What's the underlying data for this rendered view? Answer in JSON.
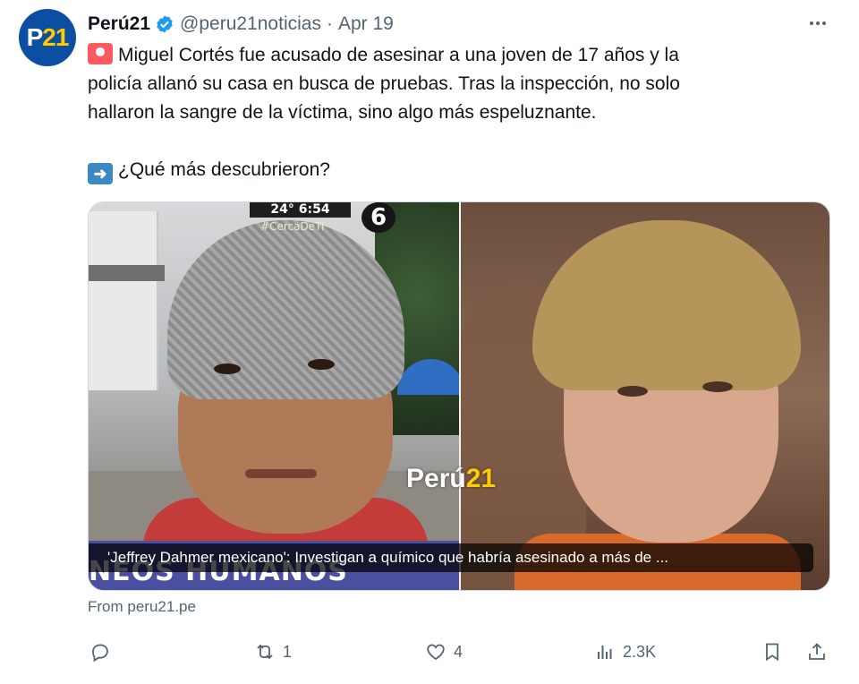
{
  "author": {
    "avatar_text_p": "P",
    "avatar_text_n": "21",
    "name": "Perú21",
    "handle": "@peru21noticias",
    "separator": "·",
    "date": "Apr 19"
  },
  "post": {
    "line1": "Miguel Cortés fue acusado de asesinar a una joven de 17 años y la",
    "line2": "policía allanó su casa en busca de pruebas. Tras la inspección, no solo",
    "line3": "hallaron la sangre de la víctima, sino algo más espeluznante.",
    "line4": "¿Qué más descubrieron?",
    "emoji_1": "siren-icon",
    "emoji_2": "arrow-right-icon"
  },
  "card": {
    "caption": "'Jeffrey Dahmer mexicano': Investigan a químico que habría asesinado a más de ...",
    "brand_text": "Perú",
    "brand_num": "21",
    "tv_time": "24° 6:54",
    "tv_tag": "#CercaDeTi",
    "tv_channel": "6",
    "overlay_text": "NEOS HUMANOS",
    "source": "From peru21.pe"
  },
  "actions": {
    "reply": {
      "icon": "reply-icon",
      "count": ""
    },
    "repost": {
      "icon": "repost-icon",
      "count": "1"
    },
    "like": {
      "icon": "heart-icon",
      "count": "4"
    },
    "views": {
      "icon": "views-icon",
      "count": "2.3K"
    },
    "bookmark": {
      "icon": "bookmark-icon"
    },
    "share": {
      "icon": "share-icon"
    }
  },
  "colors": {
    "brand_blue": "#0c4ea2",
    "verified": "#1d9bf0",
    "muted": "#536471",
    "text": "#0f1419"
  }
}
